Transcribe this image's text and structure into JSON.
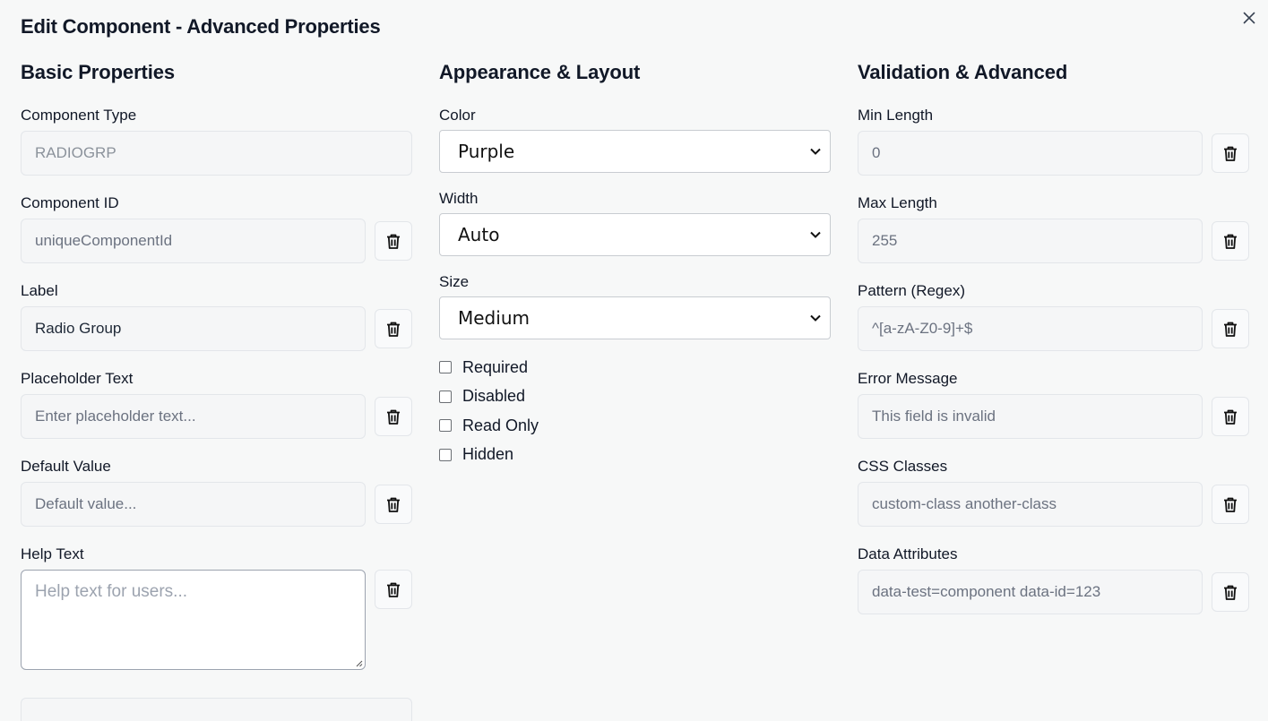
{
  "dialog": {
    "title": "Edit Component - Advanced Properties",
    "close_icon": "close-icon"
  },
  "basic": {
    "title": "Basic Properties",
    "component_type": {
      "label": "Component Type",
      "value": "RADIOGRP"
    },
    "component_id": {
      "label": "Component ID",
      "placeholder": "uniqueComponentId"
    },
    "label": {
      "label": "Label",
      "value": "Radio Group"
    },
    "placeholder_text": {
      "label": "Placeholder Text",
      "placeholder": "Enter placeholder text..."
    },
    "default_value": {
      "label": "Default Value",
      "placeholder": "Default value..."
    },
    "help_text": {
      "label": "Help Text",
      "placeholder": "Help text for users..."
    }
  },
  "appearance": {
    "title": "Appearance & Layout",
    "color": {
      "label": "Color",
      "value": "Purple"
    },
    "width": {
      "label": "Width",
      "value": "Auto"
    },
    "size": {
      "label": "Size",
      "value": "Medium"
    },
    "checkboxes": [
      {
        "label": "Required",
        "checked": false
      },
      {
        "label": "Disabled",
        "checked": false
      },
      {
        "label": "Read Only",
        "checked": false
      },
      {
        "label": "Hidden",
        "checked": false
      }
    ]
  },
  "validation": {
    "title": "Validation & Advanced",
    "min_length": {
      "label": "Min Length",
      "placeholder": "0"
    },
    "max_length": {
      "label": "Max Length",
      "placeholder": "255"
    },
    "pattern": {
      "label": "Pattern (Regex)",
      "placeholder": "^[a-zA-Z0-9]+$"
    },
    "error_message": {
      "label": "Error Message",
      "placeholder": "This field is invalid"
    },
    "css_classes": {
      "label": "CSS Classes",
      "placeholder": "custom-class another-class"
    },
    "data_attributes": {
      "label": "Data Attributes",
      "placeholder": "data-test=component data-id=123"
    }
  },
  "icons": {
    "delete": "trash-icon",
    "dropdown": "chevron-down-icon"
  }
}
